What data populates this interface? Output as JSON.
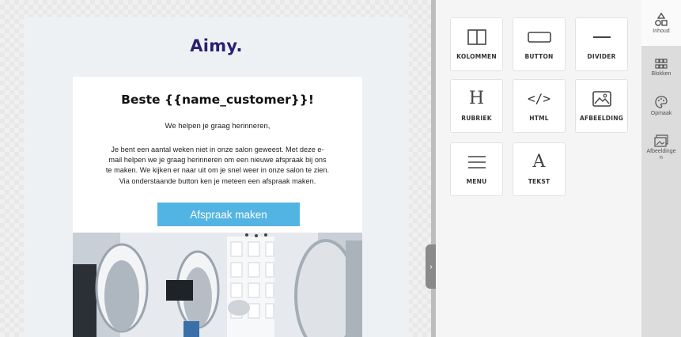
{
  "email": {
    "logo": "Aimy.",
    "greeting": "Beste {{name_customer}}!",
    "intro": "We helpen je graag herinneren,",
    "body_lines": [
      "Je bent een aantal weken niet in onze salon geweest. Met deze e-",
      "mail helpen we je graag herinneren om een nieuwe afspraak bij ons",
      "te maken. We kijken er naar uit om je snel weer in onze salon te zien.",
      "Via onderstaande button ken je meteen een afspraak maken."
    ],
    "cta_label": "Afspraak maken"
  },
  "content_blocks": [
    {
      "label": "KOLOMMEN",
      "icon": "columns-icon"
    },
    {
      "label": "BUTTON",
      "icon": "button-icon"
    },
    {
      "label": "DIVIDER",
      "icon": "divider-icon"
    },
    {
      "label": "RUBRIEK",
      "icon": "heading-icon",
      "glyph": "H"
    },
    {
      "label": "HTML",
      "icon": "code-icon",
      "glyph": "</>"
    },
    {
      "label": "AFBEELDING",
      "icon": "image-icon"
    },
    {
      "label": "MENU",
      "icon": "menu-icon"
    },
    {
      "label": "TEKST",
      "icon": "text-icon",
      "glyph": "A"
    }
  ],
  "sidebar": [
    {
      "label": "Inhoud",
      "icon": "content-icon",
      "active": true
    },
    {
      "label": "Blokken",
      "icon": "blocks-icon",
      "active": false
    },
    {
      "label": "Opmaak",
      "icon": "palette-icon",
      "active": false
    },
    {
      "label": "Afbeeldinge\nn",
      "icon": "images-icon",
      "active": false
    }
  ],
  "colors": {
    "logo": "#2a1f6e",
    "cta": "#52b4e2",
    "sidebar_bg": "#dcdcdc"
  }
}
